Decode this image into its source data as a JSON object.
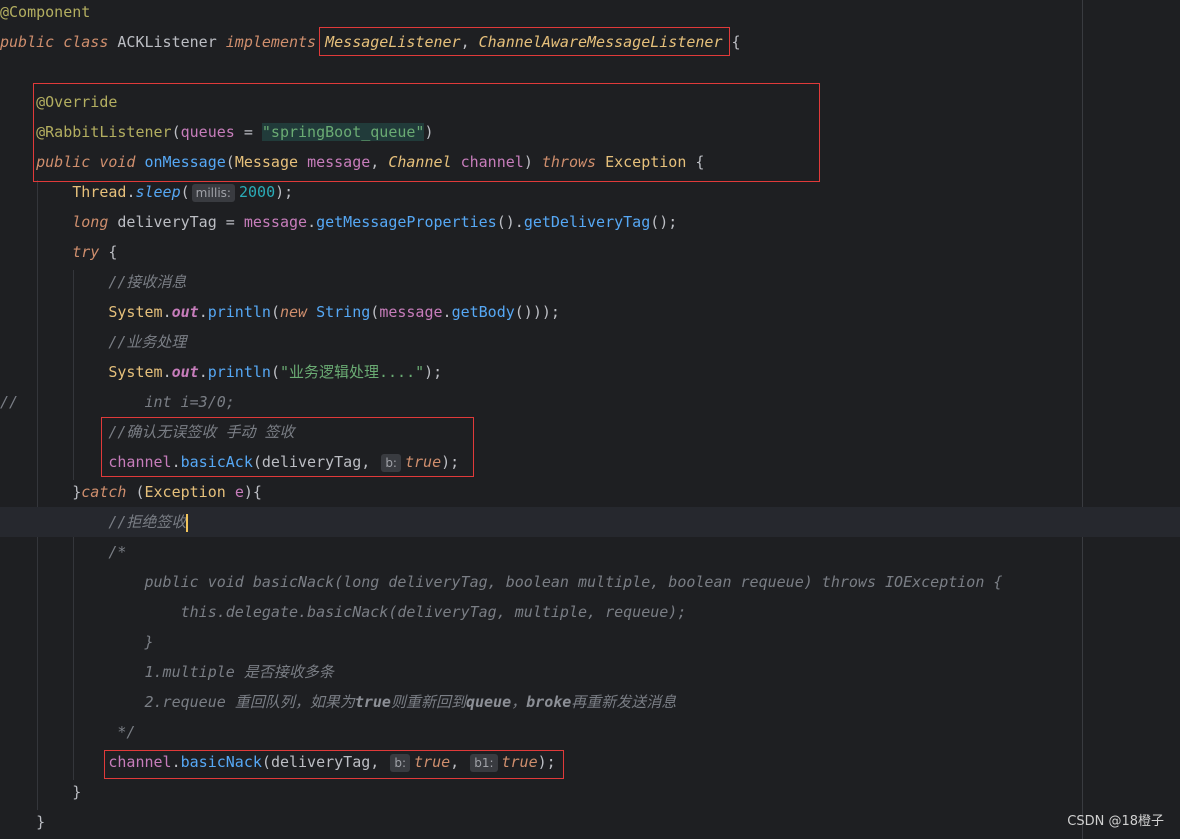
{
  "code": {
    "l1": "@Component",
    "l2_public": "public",
    "l2_class": "class",
    "l2_name": "ACKListener",
    "l2_implements": "implements",
    "l2_iface1": "MessageListener",
    "l2_comma": ", ",
    "l2_iface2": "ChannelAwareMessageListener",
    "l2_brace": " {",
    "l4": "@Override",
    "l5_anno": "@RabbitListener",
    "l5_param": "queues",
    "l5_eq": " = ",
    "l5_str": "\"springBoot_queue\"",
    "l6_public": "public",
    "l6_void": "void",
    "l6_name": "onMessage",
    "l6_t1": "Message",
    "l6_p1": "message",
    "l6_t2": "Channel",
    "l6_p2": "channel",
    "l6_throws": "throws",
    "l6_ex": "Exception",
    "l7_cls": "Thread",
    "l7_m": "sleep",
    "l7_hint": "millis:",
    "l7_num": "2000",
    "l8_long": "long",
    "l8_var": "deliveryTag",
    "l8_msg": "message",
    "l8_m1": "getMessageProperties",
    "l8_m2": "getDeliveryTag",
    "l9_try": "try",
    "l10_cmt": "//接收消息",
    "l11_sys": "System",
    "l11_out": "out",
    "l11_println": "println",
    "l11_new": "new",
    "l11_String": "String",
    "l11_msg": "message",
    "l11_getBody": "getBody",
    "l12_cmt": "//业务处理",
    "l13_sys": "System",
    "l13_out": "out",
    "l13_println": "println",
    "l13_str": "\"业务逻辑处理....\"",
    "l14_mark": "//",
    "l14_code": "int i=3/0;",
    "l15_cmt": "//确认无误签收 手动 签收",
    "l16_ch": "channel",
    "l16_m": "basicAck",
    "l16_arg": "deliveryTag",
    "l16_hint": "b:",
    "l16_true": "true",
    "l17_catch": "catch",
    "l17_ex": "Exception",
    "l17_e": "e",
    "l18_cmt": "//拒绝签收",
    "l19_cmt": "/*",
    "l20": "public void basicNack(long deliveryTag, boolean multiple, boolean requeue) throws IOException {",
    "l21": "this.delegate.basicNack(deliveryTag, multiple, requeue);",
    "l22": "}",
    "l23_a": "1.multiple",
    "l23_b": "是否接收多条",
    "l24_a": "2.requeue",
    "l24_b": "重回队列，如果为",
    "l24_c": "true",
    "l24_d": "则重新回到",
    "l24_e": "queue",
    "l24_f": "，",
    "l24_g": "broke",
    "l24_h": "再重新发送消息",
    "l25": "*/",
    "l26_ch": "channel",
    "l26_m": "basicNack",
    "l26_arg": "deliveryTag",
    "l26_hint1": "b:",
    "l26_true1": "true",
    "l26_hint2": "b1:",
    "l26_true2": "true",
    "l27": "}",
    "l28": "}"
  },
  "watermark": "CSDN @18橙子",
  "colors": {
    "background": "#1e1f22",
    "highlight_box": "#e03a3a",
    "keyword": "#cf8e6d",
    "method": "#56a8f5",
    "string": "#6aab73"
  }
}
